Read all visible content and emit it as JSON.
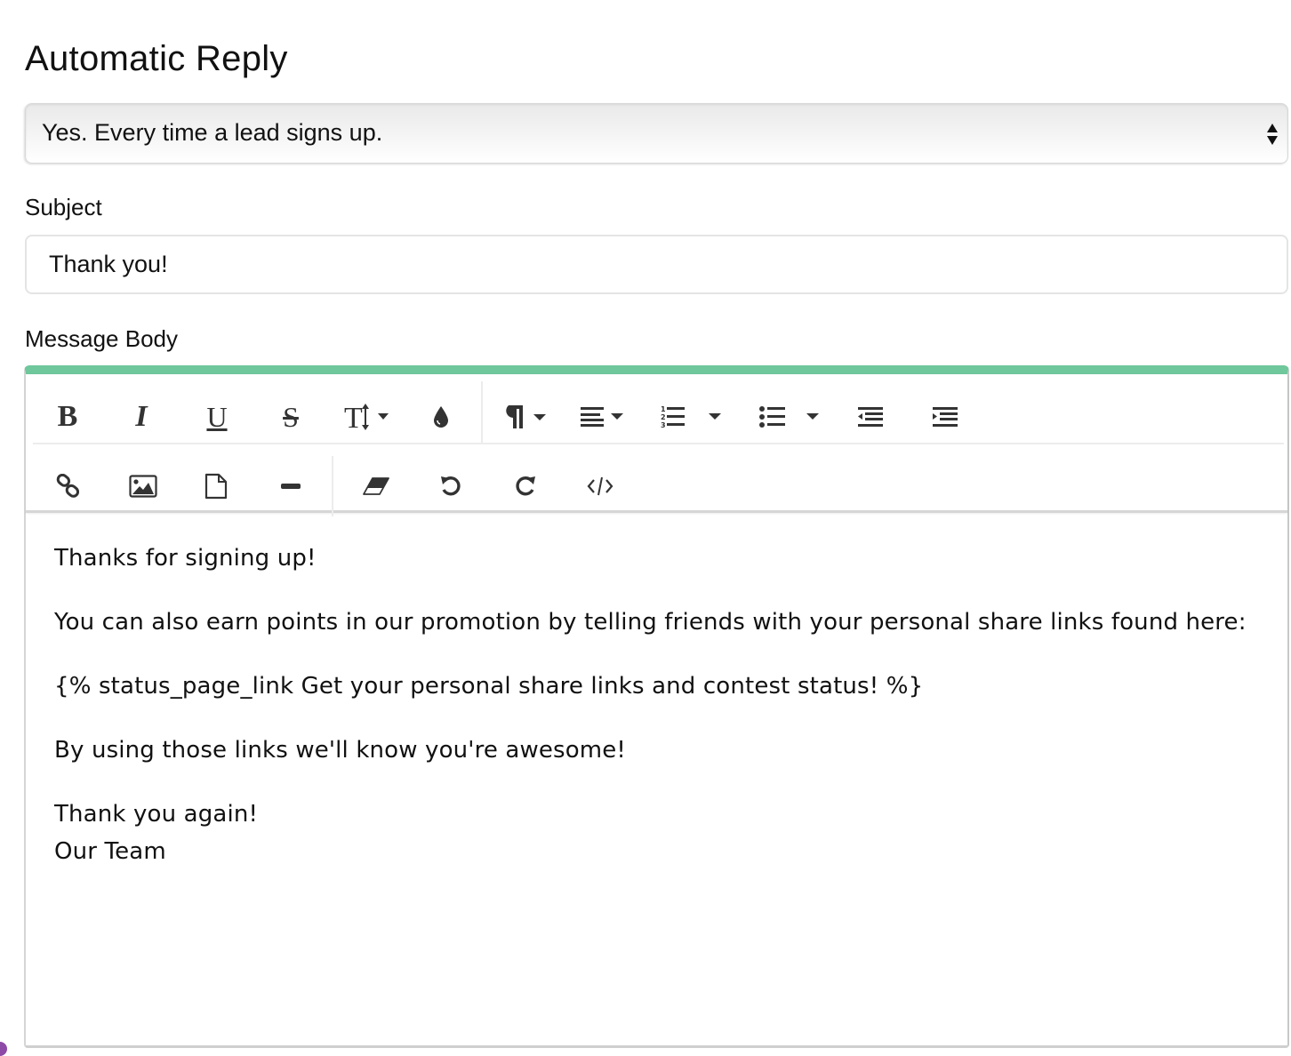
{
  "page": {
    "title": "Automatic Reply"
  },
  "auto_reply": {
    "selected_option": "Yes. Every time a lead signs up."
  },
  "subject": {
    "label": "Subject",
    "value": "Thank you!"
  },
  "message_body": {
    "label": "Message Body",
    "accent_color": "#6fc79c",
    "toolbar": {
      "row1": [
        {
          "name": "bold",
          "icon": "bold-icon",
          "glyph": "B"
        },
        {
          "name": "italic",
          "icon": "italic-icon",
          "glyph": "I"
        },
        {
          "name": "underline",
          "icon": "underline-icon",
          "glyph": "U"
        },
        {
          "name": "strikethrough",
          "icon": "strikethrough-icon",
          "glyph": "S"
        },
        {
          "name": "font-size",
          "icon": "text-height-icon",
          "glyph": "T"
        },
        {
          "name": "color",
          "icon": "color-drop-icon"
        },
        {
          "name": "paragraph-format",
          "icon": "paragraph-icon",
          "glyph": "¶"
        },
        {
          "name": "align",
          "icon": "align-left-icon"
        },
        {
          "name": "ordered-list",
          "icon": "ordered-list-icon"
        },
        {
          "name": "unordered-list",
          "icon": "unordered-list-icon"
        },
        {
          "name": "outdent",
          "icon": "outdent-icon"
        },
        {
          "name": "indent",
          "icon": "indent-icon"
        }
      ],
      "row2": [
        {
          "name": "insert-link",
          "icon": "link-icon"
        },
        {
          "name": "insert-image",
          "icon": "image-icon"
        },
        {
          "name": "insert-file",
          "icon": "file-icon"
        },
        {
          "name": "horizontal-rule",
          "icon": "horizontal-rule-icon"
        },
        {
          "name": "clear-formatting",
          "icon": "eraser-icon"
        },
        {
          "name": "undo",
          "icon": "undo-icon"
        },
        {
          "name": "redo",
          "icon": "redo-icon"
        },
        {
          "name": "code-view",
          "icon": "code-icon"
        }
      ]
    },
    "paragraphs": [
      "Thanks for signing up!",
      "You can also earn points in our promotion by telling friends with your personal share links found here:",
      "{% status_page_link Get your personal share links and contest status! %}",
      "By using those links we'll know you're awesome!"
    ],
    "closing_line1": "Thank you again!",
    "closing_line2": "Our Team"
  }
}
